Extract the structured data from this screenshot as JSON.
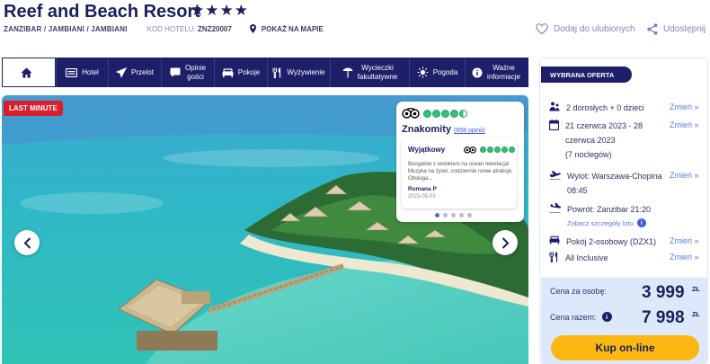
{
  "hotel": {
    "name": "Reef and Beach Resort",
    "stars": "★★★★",
    "location": "ZANZIBAR / JAMBIANI / JAMBIANI",
    "code_label": "KOD HOTELU:",
    "code": "ZNZ20007",
    "map_link": "POKAŻ NA MAPIE"
  },
  "actions": {
    "favorite": "Dodaj do ulubionych",
    "share": "Udostępnij"
  },
  "nav": {
    "items": [
      {
        "label": "",
        "icon": "home-icon"
      },
      {
        "label": "Hotel",
        "icon": "hotel-icon"
      },
      {
        "label": "Przelot",
        "icon": "plane-icon"
      },
      {
        "label_line1": "Opinie",
        "label_line2": "gości",
        "icon": "chat-icon"
      },
      {
        "label": "Pokoje",
        "icon": "bed-icon"
      },
      {
        "label": "Wyżywienie",
        "icon": "cutlery-icon"
      },
      {
        "label_line1": "Wycieczki",
        "label_line2": "fakultatywne",
        "icon": "excursion-icon"
      },
      {
        "label": "Pogoda",
        "icon": "sun-icon"
      },
      {
        "label_line1": "Ważne",
        "label_line2": "informacje",
        "icon": "info-icon"
      }
    ]
  },
  "gallery": {
    "badge": "LAST MINUTE",
    "review_summary": {
      "rating_label": "Znakomity",
      "rating_count": "(658 opinii)",
      "rating_fraction": 0.9
    },
    "review": {
      "title": "Wyjątkowy",
      "text": "Bungalow z widokiem na ocean rewelacja! Muzyka na żywo, codziennie nowe atrakcje. Obsługa...",
      "author": "Romana P",
      "date": "2023-05-03"
    }
  },
  "offer": {
    "tag": "WYBRANA OFERTA",
    "change_label": "Zmień »",
    "travellers": "2 dorosłych + 0 dzieci",
    "dates_line1": "21 czerwca 2023 - 28",
    "dates_line2": "czerwca 2023",
    "dates_line3": "(7 noclegów)",
    "departure_line1": "Wylot: Warszawa-Chopina",
    "departure_line2": "08:45",
    "return": "Powrót: Zanzibar 21:20",
    "flight_details": "Zobacz szczegóły lotu",
    "room": "Pokój 2-osobowy (DZX1)",
    "board": "All Inclusive",
    "price_person_label": "Cena za osobę:",
    "price_person": "3 999",
    "price_total_label": "Cena razem:",
    "price_total": "7 998",
    "currency": "ZŁ",
    "buy_label": "Kup on-line"
  },
  "colors": {
    "navy": "#1d1f69",
    "accent_blue": "#5b7be0",
    "buy_yellow": "#fbb712",
    "last_minute_red": "#d81f2b",
    "price_bg": "#dde9fb"
  }
}
